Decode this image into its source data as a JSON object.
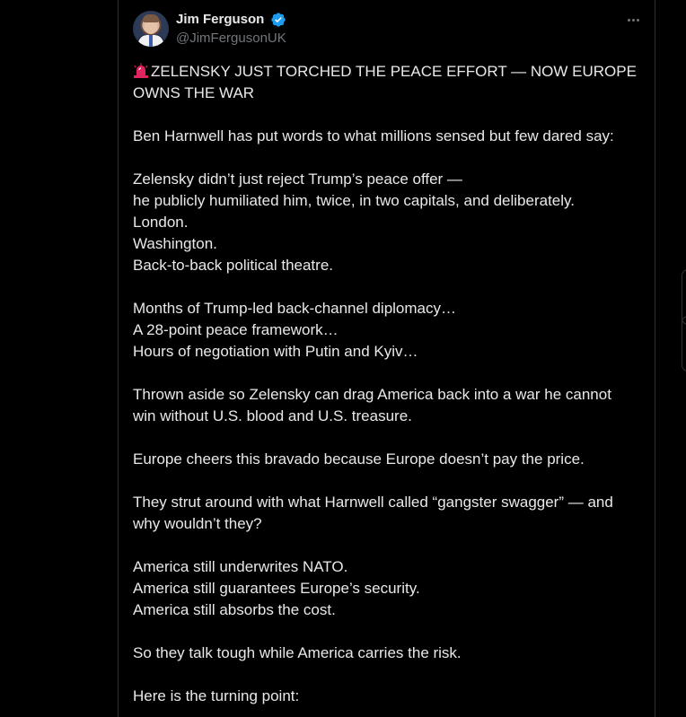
{
  "post": {
    "author": {
      "display_name": "Jim Ferguson",
      "handle": "@JimFergusonUK",
      "verified": true
    },
    "more_icon": "ellipsis-icon",
    "headline_icon": "siren-icon",
    "paragraphs": [
      [
        "ZELENSKY JUST TORCHED THE PEACE EFFORT — NOW EUROPE",
        "OWNS THE WAR"
      ],
      [
        "Ben Harnwell has put words to what millions sensed but few dared say:"
      ],
      [
        "Zelensky didn’t just reject Trump’s peace offer —",
        "he publicly humiliated him, twice, in two capitals, and deliberately.",
        "London.",
        "Washington.",
        "Back-to-back political theatre."
      ],
      [
        "Months of Trump-led back-channel diplomacy…",
        "A 28-point peace framework…",
        "Hours of negotiation with Putin and Kyiv…"
      ],
      [
        "Thrown aside so Zelensky can drag America back into a war he cannot",
        "win without U.S. blood and U.S. treasure."
      ],
      [
        "Europe cheers this bravado because Europe doesn’t pay the price."
      ],
      [
        "They strut around with what Harnwell called “gangster swagger” — and",
        "why wouldn’t they?"
      ],
      [
        "America still underwrites NATO.",
        "America still guarantees Europe’s security.",
        "America still absorbs the cost."
      ],
      [
        "So they talk tough while America carries the risk."
      ],
      [
        "Here is the turning point:"
      ]
    ]
  },
  "colors": {
    "background": "#000000",
    "text_primary": "#e7e9ea",
    "text_secondary": "#71767b",
    "border": "#2f3336",
    "verified_blue": "#1d9bf0",
    "siren_red": "#e0245e"
  }
}
